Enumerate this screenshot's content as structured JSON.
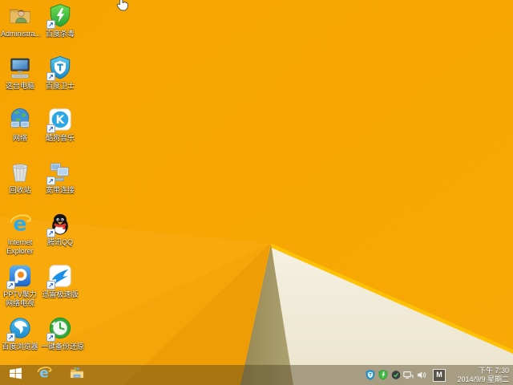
{
  "desktop": {
    "icons": [
      {
        "label": "Administra..."
      },
      {
        "label": "百度杀毒"
      },
      {
        "label": "这台电脑"
      },
      {
        "label": "百度卫士"
      },
      {
        "label": "网络"
      },
      {
        "label": "酷狗音乐"
      },
      {
        "label": "回收站"
      },
      {
        "label": "宽带连接"
      },
      {
        "label": "Internet Explorer"
      },
      {
        "label": "腾讯QQ"
      },
      {
        "label": "PPTV聚力 网络电视"
      },
      {
        "label": "迅雷极速版"
      },
      {
        "label": "百度浏览器"
      },
      {
        "label": "一键备份还原"
      }
    ]
  },
  "taskbar": {
    "input_indicator": "M",
    "clock": {
      "time": "下午 7:30",
      "date": "2014/9/9 星期二"
    }
  },
  "icons_meta": {
    "shortcut_arrow_glyph": "↗",
    "kugou_letter": "K",
    "ie_letter": "e"
  },
  "wallpaper_colors": {
    "base_orange": "#F7A704",
    "facet_light": "#F8A90C",
    "facet_mid": "#F4A509",
    "facet_dark": "#EE9D04",
    "edge_highlight": "#FFC103",
    "cream_wedge": "#F2EDDB",
    "olive_wedge": "#A3966A",
    "taskbar_tint": "rgba(80,67,34,0.44)"
  }
}
